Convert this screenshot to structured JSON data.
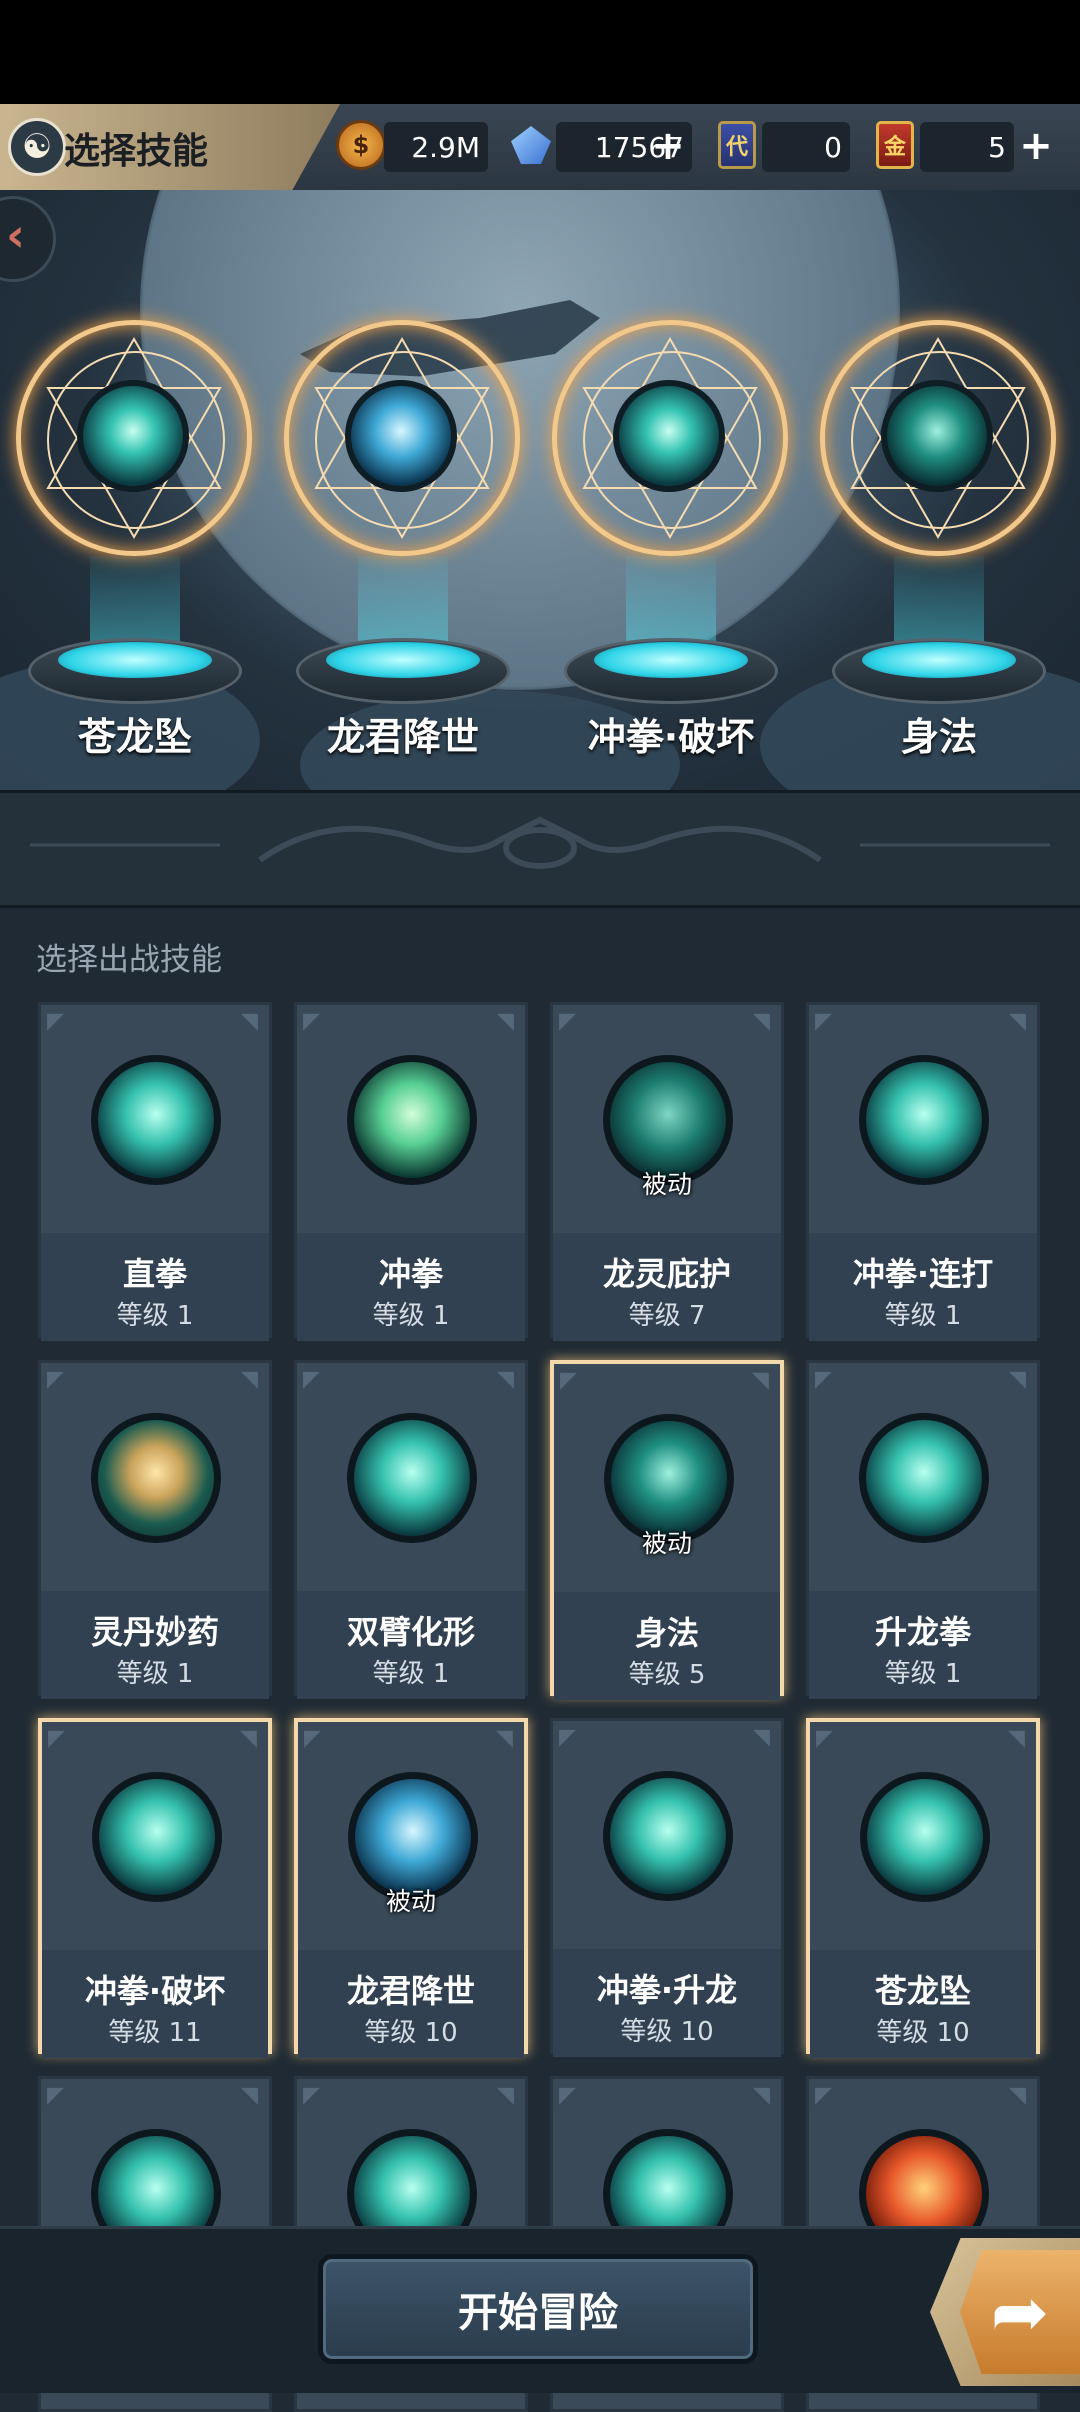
{
  "header": {
    "title": "选择技能",
    "title_icon": "swirl-icon",
    "coins": "2.9M",
    "gems": "17567",
    "ticket_blue_icon_text": "代",
    "ticket_blue": "0",
    "ticket_red_icon_text": "金",
    "ticket_red": "5",
    "plus": "+"
  },
  "equipped": [
    {
      "name": "苍龙坠"
    },
    {
      "name": "龙君降世"
    },
    {
      "name": "冲拳·破坏"
    },
    {
      "name": "身法"
    }
  ],
  "section_label": "选择出战技能",
  "skills": [
    {
      "name": "直拳",
      "level": "等级 1",
      "passive": "",
      "selected": false
    },
    {
      "name": "冲拳",
      "level": "等级 1",
      "passive": "",
      "selected": false
    },
    {
      "name": "龙灵庇护",
      "level": "等级 7",
      "passive": "被动",
      "selected": false
    },
    {
      "name": "冲拳·连打",
      "level": "等级 1",
      "passive": "",
      "selected": false
    },
    {
      "name": "灵丹妙药",
      "level": "等级 1",
      "passive": "",
      "selected": false
    },
    {
      "name": "双臂化形",
      "level": "等级 1",
      "passive": "",
      "selected": false
    },
    {
      "name": "身法",
      "level": "等级 5",
      "passive": "被动",
      "selected": true
    },
    {
      "name": "升龙拳",
      "level": "等级 1",
      "passive": "",
      "selected": false
    },
    {
      "name": "冲拳·破坏",
      "level": "等级 11",
      "passive": "",
      "selected": true
    },
    {
      "name": "龙君降世",
      "level": "等级 10",
      "passive": "被动",
      "selected": true
    },
    {
      "name": "冲拳·升龙",
      "level": "等级 10",
      "passive": "",
      "selected": false
    },
    {
      "name": "苍龙坠",
      "level": "等级 10",
      "passive": "",
      "selected": true
    }
  ],
  "footer": {
    "start_label": "开始冒险",
    "arrow_icon": "share-arrow-icon"
  },
  "colors": {
    "selected_border": "#f3d8ac",
    "seal_glow": "#f2c98a",
    "teal": "#35c2ae"
  }
}
